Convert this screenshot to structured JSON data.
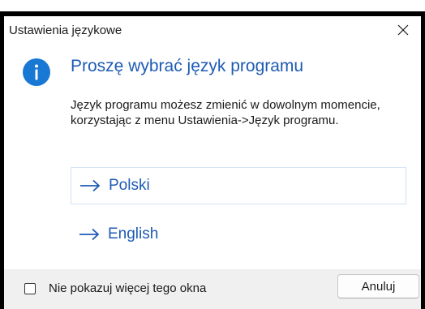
{
  "window": {
    "title": "Ustawienia językowe",
    "close_icon": "close-icon"
  },
  "content": {
    "icon": "info-icon",
    "heading": "Proszę wybrać język programu",
    "description": "Język programu możesz zmienić w dowolnym momencie, korzystając z menu Ustawienia->Język programu.",
    "options": [
      {
        "label": "Polski",
        "icon": "arrow-right-icon"
      },
      {
        "label": "English",
        "icon": "arrow-right-icon"
      }
    ]
  },
  "footer": {
    "checkbox_label": "Nie pokazuj więcej tego okna",
    "checkbox_checked": false,
    "cancel_label": "Anuluj"
  },
  "colors": {
    "accent": "#1e5bb5",
    "info_icon": "#1978d4",
    "footer_bg": "#f0f0f0"
  }
}
